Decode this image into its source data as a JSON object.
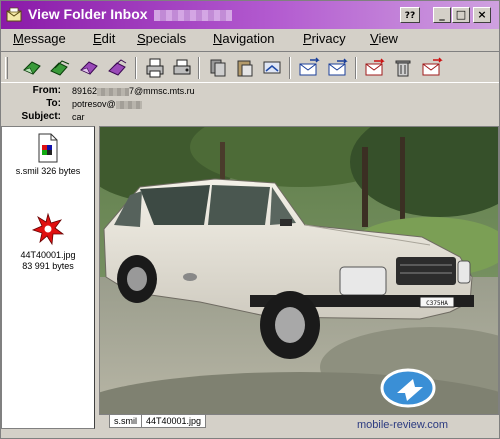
{
  "window": {
    "title": "View Folder Inbox",
    "help_button": "?",
    "minimize_button": "_",
    "maximize_button": "□",
    "close_button": "×"
  },
  "menu": [
    {
      "label": "Message",
      "accel": "M",
      "rest": "essage"
    },
    {
      "label": "Edit",
      "accel": "E",
      "rest": "dit"
    },
    {
      "label": "Specials",
      "accel": "S",
      "rest": "pecials"
    },
    {
      "label": "Navigation",
      "accel": "N",
      "rest": "avigation"
    },
    {
      "label": "Privacy",
      "accel": "P",
      "rest": "rivacy"
    },
    {
      "label": "View",
      "accel": "V",
      "rest": "iew"
    }
  ],
  "toolbar": {
    "icons": [
      "reply-icon",
      "reply-all-icon",
      "forward-icon",
      "forward-as-attachment-icon",
      "print-icon",
      "print-setup-icon",
      "copy-icon",
      "paste-icon",
      "move-icon",
      "send-receive-icon",
      "new-message-icon",
      "delete-message-icon",
      "trash-icon",
      "mark-unread-icon"
    ]
  },
  "headers": {
    "from_label": "From:",
    "from_prefix": "89162",
    "from_suffix": "7@mmsc.mts.ru",
    "to_label": "To:",
    "to_prefix": "potresov@",
    "subject_label": "Subject:",
    "subject_value": "car"
  },
  "attachments": [
    {
      "name": "s.smil",
      "size": "326 bytes",
      "icon": "smil-file-icon"
    },
    {
      "name": "44T40001.jpg",
      "size": "83 991 bytes",
      "icon": "jpg-image-icon"
    }
  ],
  "tabs": [
    {
      "label": "s.smil",
      "active": false
    },
    {
      "label": "44T40001.jpg",
      "active": true
    }
  ],
  "watermark": "mobile-review.com",
  "colors": {
    "titlebar_start": "#8a1aa8",
    "titlebar_end": "#cfa1e0",
    "chrome": "#d4d0c8"
  }
}
